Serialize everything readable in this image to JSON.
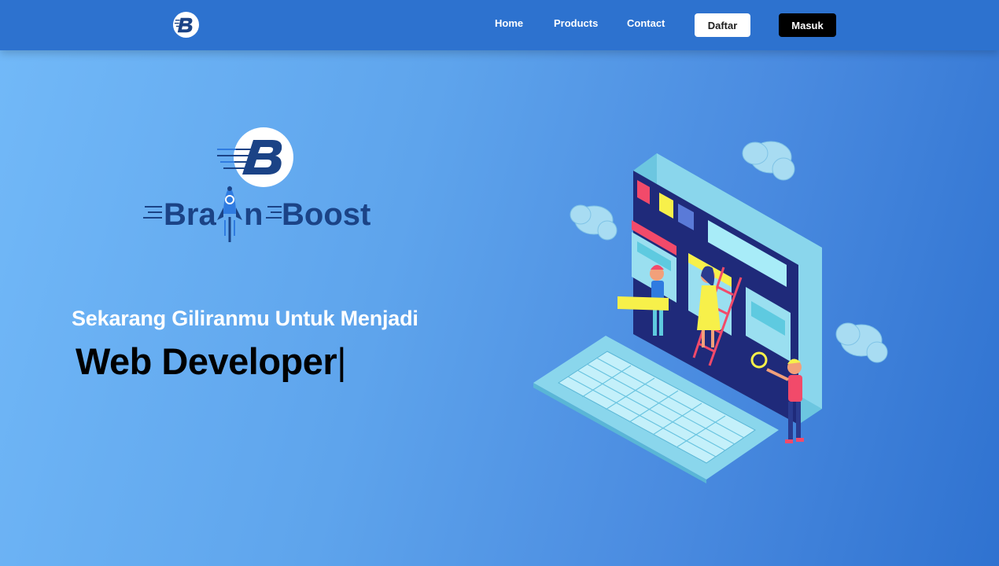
{
  "nav": {
    "logo_icon": "brainboost-b-logo-icon",
    "links": [
      "Home",
      "Products",
      "Contact"
    ],
    "signup_label": "Daftar",
    "login_label": "Masuk"
  },
  "hero": {
    "brand_logo_icon": "brainboost-logo-icon",
    "brand_name_left": "Bra",
    "brand_name_mid": "n",
    "brand_name_right": "Boost",
    "tagline": "Sekarang Giliranmu Untuk Menjadi",
    "typed_text": "Web Developer",
    "cursor": "|",
    "illustration_icon": "web-developer-illustration"
  },
  "colors": {
    "navbar": "#2d72cf",
    "accent_dark": "#1b4386",
    "signup_bg": "#ffffff",
    "login_bg": "#000000"
  }
}
